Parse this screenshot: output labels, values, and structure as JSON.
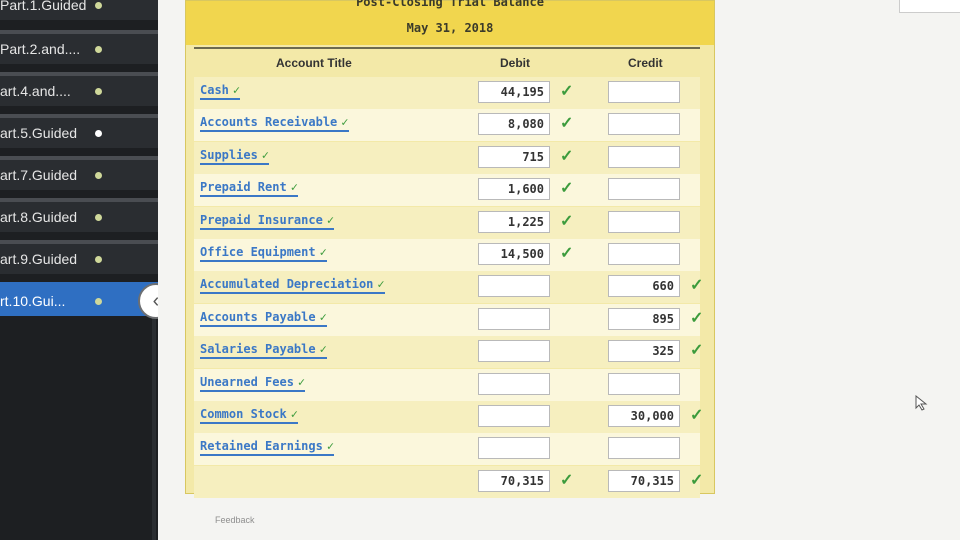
{
  "nav": {
    "items": [
      {
        "label": "Part.1.Guided",
        "dot": "green"
      },
      {
        "label": "Part.2.and....",
        "dot": "green"
      },
      {
        "label": "art.4.and....",
        "dot": "green"
      },
      {
        "label": "art.5.Guided",
        "dot": "white"
      },
      {
        "label": "art.7.Guided",
        "dot": "green"
      },
      {
        "label": "art.8.Guided",
        "dot": "green"
      },
      {
        "label": "art.9.Guided",
        "dot": "green"
      },
      {
        "label": "rt.10.Gui...",
        "dot": "green",
        "active": true
      }
    ]
  },
  "collapse_icon": "chevron-left-icon",
  "trial_balance": {
    "title": "Post-Closing Trial Balance",
    "date": "May 31, 2018",
    "headers": {
      "account": "Account Title",
      "debit": "Debit",
      "credit": "Credit"
    },
    "rows": [
      {
        "account": "Cash",
        "debit": "44,195",
        "credit": "",
        "debit_check": true,
        "credit_check": false
      },
      {
        "account": "Accounts Receivable",
        "debit": "8,080",
        "credit": "",
        "debit_check": true,
        "credit_check": false
      },
      {
        "account": "Supplies",
        "debit": "715",
        "credit": "",
        "debit_check": true,
        "credit_check": false
      },
      {
        "account": "Prepaid Rent",
        "debit": "1,600",
        "credit": "",
        "debit_check": true,
        "credit_check": false
      },
      {
        "account": "Prepaid Insurance",
        "debit": "1,225",
        "credit": "",
        "debit_check": true,
        "credit_check": false
      },
      {
        "account": "Office Equipment",
        "debit": "14,500",
        "credit": "",
        "debit_check": true,
        "credit_check": false
      },
      {
        "account": "Accumulated Depreciation",
        "debit": "",
        "credit": "660",
        "debit_check": false,
        "credit_check": true
      },
      {
        "account": "Accounts Payable",
        "debit": "",
        "credit": "895",
        "debit_check": false,
        "credit_check": true
      },
      {
        "account": "Salaries Payable",
        "debit": "",
        "credit": "325",
        "debit_check": false,
        "credit_check": true
      },
      {
        "account": "Unearned Fees",
        "debit": "",
        "credit": "",
        "debit_check": false,
        "credit_check": false
      },
      {
        "account": "Common Stock",
        "debit": "",
        "credit": "30,000",
        "debit_check": false,
        "credit_check": true
      },
      {
        "account": "Retained Earnings",
        "debit": "",
        "credit": "",
        "debit_check": false,
        "credit_check": false
      }
    ],
    "totals": {
      "debit": "70,315",
      "credit": "70,315"
    },
    "check_glyph": "✓"
  },
  "feedback_label": "Feedback",
  "colors": {
    "check": "#3c9b3c",
    "account_link": "#3b78c6",
    "header_band": "#f1d64e",
    "nav_active": "#2f6fc2"
  }
}
